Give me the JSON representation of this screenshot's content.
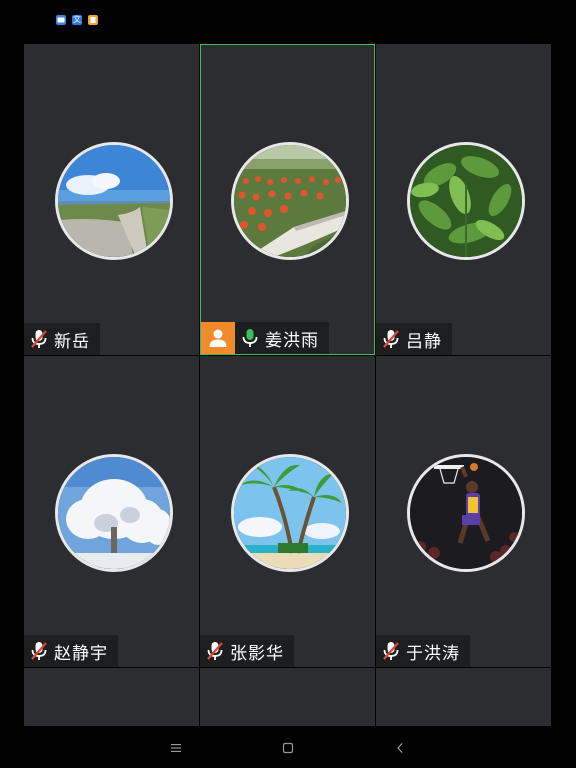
{
  "status_bar": {
    "icons": [
      {
        "name": "chat-app-icon",
        "color": "#3a86d6"
      },
      {
        "name": "translate-app-icon",
        "color": "#2f7be0",
        "glyph": "文"
      },
      {
        "name": "files-app-icon",
        "color": "#f2a33a"
      }
    ]
  },
  "participants": [
    {
      "name": "新岳",
      "avatar": "road-landscape",
      "mic": "muted",
      "host": false,
      "active": false
    },
    {
      "name": "姜洪雨",
      "avatar": "flower-field",
      "mic": "on",
      "host": true,
      "active": true
    },
    {
      "name": "吕静",
      "avatar": "green-leaves",
      "mic": "muted",
      "host": false,
      "active": false
    },
    {
      "name": "赵静宇",
      "avatar": "snowy-tree",
      "mic": "muted",
      "host": false,
      "active": false
    },
    {
      "name": "张影华",
      "avatar": "palm-trees",
      "mic": "muted",
      "host": false,
      "active": false
    },
    {
      "name": "于洪涛",
      "avatar": "basketball-dunk",
      "mic": "muted",
      "host": false,
      "active": false
    }
  ],
  "colors": {
    "tile_bg": "#2c2d30",
    "active_border": "#3bbf5a",
    "host_badge": "#f08a2b",
    "mic_on": "#3bbf5a",
    "mic_muted": "#e0463a"
  },
  "nav_bar": {
    "menu": "☰",
    "home": "▢",
    "back": "‹"
  }
}
